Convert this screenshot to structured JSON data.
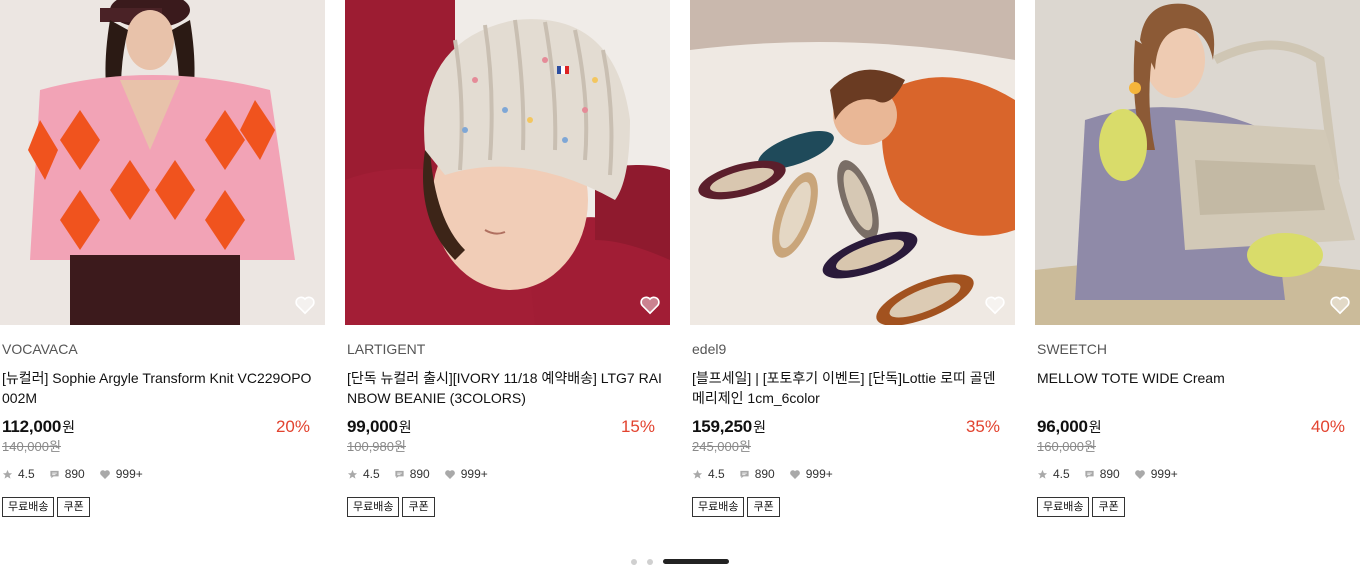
{
  "products": [
    {
      "brand": "VOCAVACA",
      "title": "[뉴컬러] Sophie Argyle Transform Knit VC229OPO002M",
      "price": "112,000",
      "currency": "원",
      "discount": "20%",
      "original_price": "140,000원",
      "rating": "4.5",
      "reviews": "890",
      "likes": "999+",
      "tags": [
        "무료배송",
        "쿠폰"
      ],
      "image_icon": "argyle-sweater-photo"
    },
    {
      "brand": "LARTIGENT",
      "title": "[단독 뉴컬러 출시][IVORY 11/18 예약배송] LTG7 RAINBOW BEANIE (3COLORS)",
      "price": "99,000",
      "currency": "원",
      "discount": "15%",
      "original_price": "100,980원",
      "rating": "4.5",
      "reviews": "890",
      "likes": "999+",
      "tags": [
        "무료배송",
        "쿠폰"
      ],
      "image_icon": "knit-beanie-photo"
    },
    {
      "brand": "edel9",
      "title": "[블프세일] | [포토후기 이벤트] [단독]Lottie 로띠 골덴 메리제인 1cm_6color",
      "price": "159,250",
      "currency": "원",
      "discount": "35%",
      "original_price": "245,000원",
      "rating": "4.5",
      "reviews": "890",
      "likes": "999+",
      "tags": [
        "무료배송",
        "쿠폰"
      ],
      "image_icon": "mary-jane-shoes-photo"
    },
    {
      "brand": "SWEETCH",
      "title": "MELLOW TOTE WIDE Cream",
      "price": "96,000",
      "currency": "원",
      "discount": "40%",
      "original_price": "160,000원",
      "rating": "4.5",
      "reviews": "890",
      "likes": "999+",
      "tags": [
        "무료배송",
        "쿠폰"
      ],
      "image_icon": "tote-bag-photo"
    }
  ],
  "pagination": {
    "pages": 3,
    "active": 3
  },
  "colors": {
    "discount": "#e2432f",
    "strike": "#8a8a8a",
    "active_bar": "#222222",
    "inactive_dot": "#d0d0d0"
  }
}
